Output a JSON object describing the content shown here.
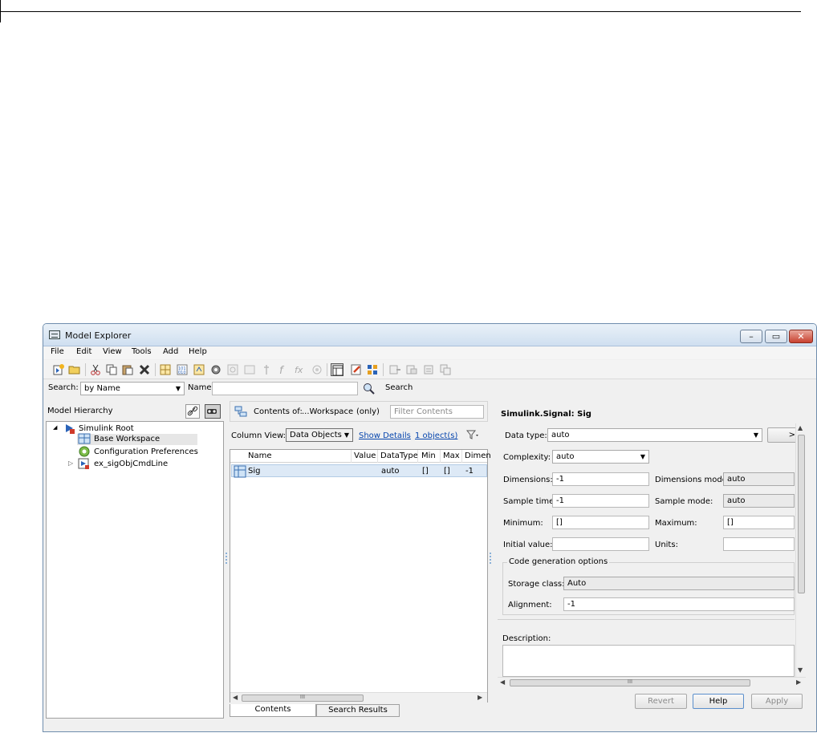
{
  "window": {
    "title": "Model Explorer"
  },
  "menu": [
    "File",
    "Edit",
    "View",
    "Tools",
    "Add",
    "Help"
  ],
  "toolbar_icons": [
    "new-model-icon",
    "open-icon",
    "cut-icon",
    "copy-icon",
    "paste-icon",
    "delete-icon",
    "add-workspace-icon",
    "add-data-icon",
    "add-config-icon",
    "add-config-set-icon",
    "disabled-icon-1",
    "disabled-icon-2",
    "disabled-icon-3",
    "stateflow-function-icon",
    "fx-icon",
    "disabled-icon-4",
    "dialog-view-icon",
    "model-advisor-icon",
    "contents-grid-icon",
    "forward-icon",
    "back-icon",
    "copy-object-icon",
    "paste-object-icon"
  ],
  "search": {
    "label": "Search:",
    "mode": "by Name",
    "name_label": "Name:",
    "name_value": "",
    "button": "Search"
  },
  "hierarchy": {
    "title": "Model Hierarchy",
    "items": [
      {
        "label": "Simulink Root",
        "expander": "◢"
      },
      {
        "label": "Base Workspace"
      },
      {
        "label": "Configuration Preferences"
      },
      {
        "label": "ex_sigObjCmdLine",
        "expander": "▷"
      }
    ]
  },
  "contents": {
    "label": "Contents of:",
    "scope": "...Workspace",
    "only": "(only)",
    "filter_placeholder": "Filter Contents",
    "column_view_label": "Column View:",
    "column_view": "Data Objects",
    "show_details": "Show Details",
    "object_count": "1 object(s)",
    "columns": [
      "Name",
      "Value",
      "DataType",
      "Min",
      "Max",
      "Dimen"
    ],
    "rows": [
      {
        "name": "Sig",
        "value": "",
        "datatype": "auto",
        "min": "[]",
        "max": "[]",
        "dimen": "-1"
      }
    ],
    "hscroll_mid": "III",
    "tabs": [
      "Contents",
      "Search Results"
    ]
  },
  "dialog": {
    "title": "Simulink.Signal: Sig",
    "data_type_label": "Data type:",
    "data_type": "auto",
    "assistant_button": ">",
    "complexity_label": "Complexity:",
    "complexity": "auto",
    "dimensions_label": "Dimensions:",
    "dimensions": "-1",
    "dimensions_mode_label": "Dimensions mode:",
    "dimensions_mode": "auto",
    "sample_time_label": "Sample time:",
    "sample_time": "-1",
    "sample_mode_label": "Sample mode:",
    "sample_mode": "auto",
    "minimum_label": "Minimum:",
    "minimum": "[]",
    "maximum_label": "Maximum:",
    "maximum": "[]",
    "initial_value_label": "Initial value:",
    "initial_value": "",
    "units_label": "Units:",
    "units": "",
    "codegen_title": "Code generation options",
    "storage_class_label": "Storage class:",
    "storage_class": "Auto",
    "alignment_label": "Alignment:",
    "alignment": "-1",
    "description_label": "Description:",
    "description": "",
    "hscroll_mid": "III",
    "buttons": {
      "revert": "Revert",
      "help": "Help",
      "apply": "Apply"
    }
  }
}
